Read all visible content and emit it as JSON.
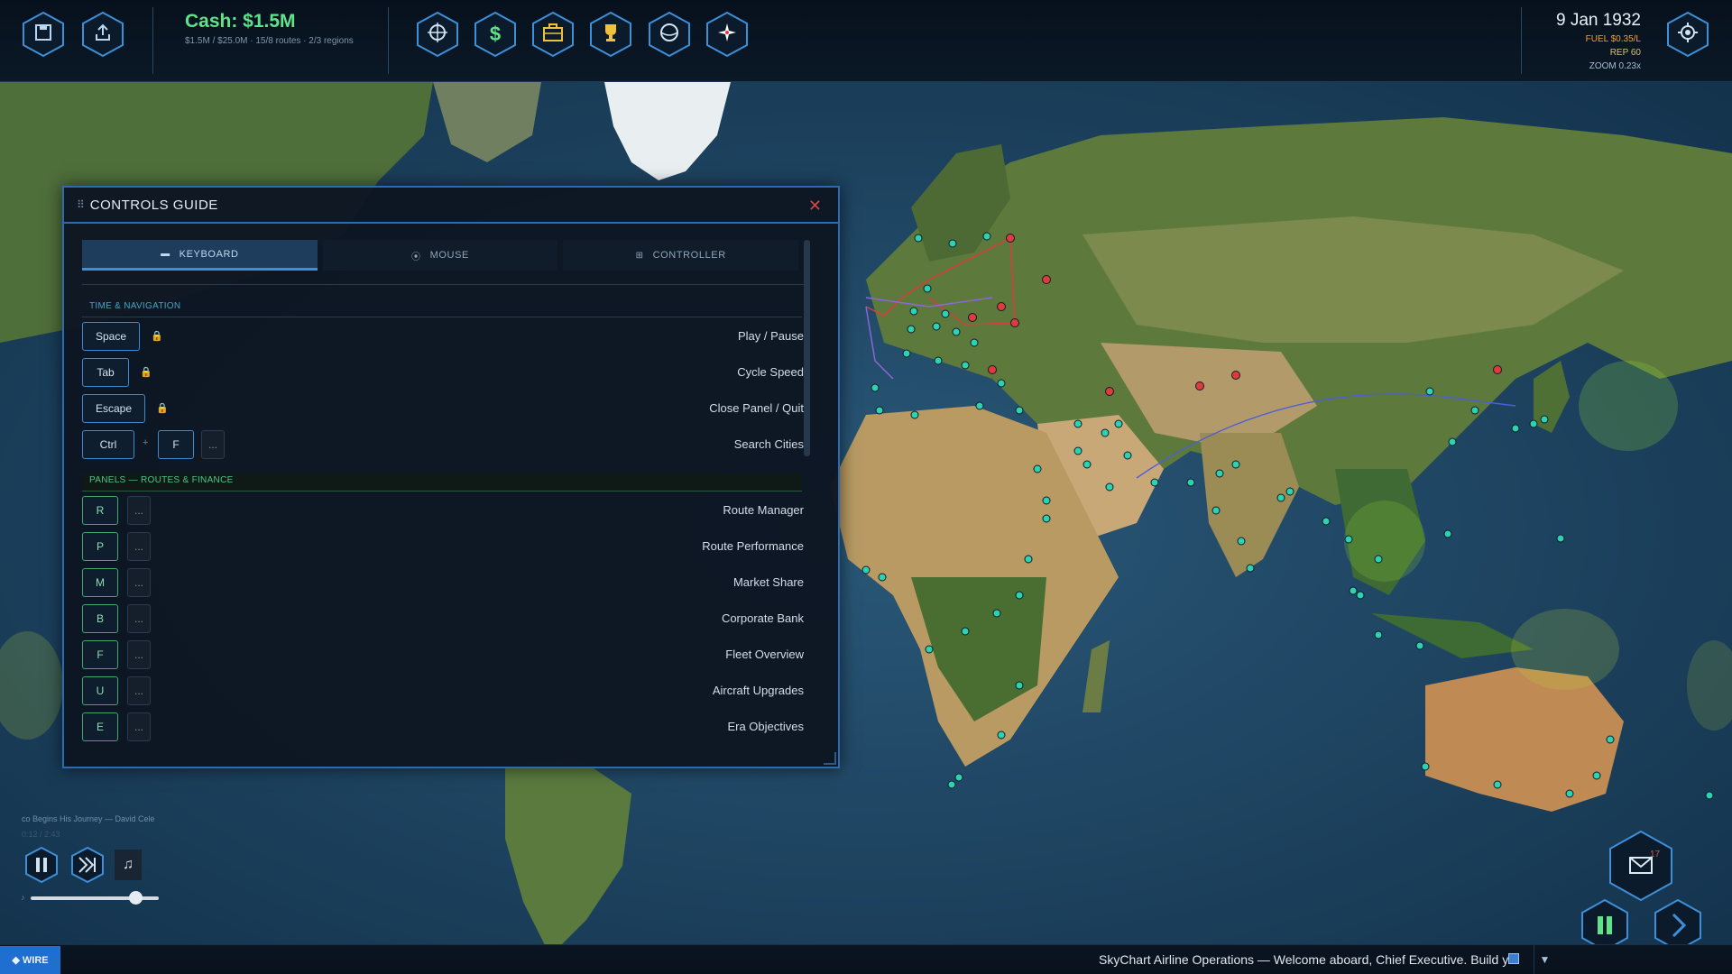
{
  "toolbar": {
    "save_icon": "save-icon",
    "export_icon": "export-icon",
    "cash_label": "Cash: $1.5M",
    "cash_sub": "$1.5M / $25.0M  ·  15/8 routes  ·  2/3 regions",
    "tool_icons": [
      "crosshair-icon",
      "dollar-icon",
      "briefcase-icon",
      "trophy-icon",
      "globe-icon",
      "compass-icon"
    ],
    "date": "9 Jan 1932",
    "fuel": "FUEL $0.35/L",
    "rep": "REP 60",
    "zoom": "ZOOM 0.23x",
    "settings_icon": "settings-icon"
  },
  "panel": {
    "title": "CONTROLS GUIDE",
    "tabs": [
      {
        "label": "KEYBOARD",
        "icon": "keyboard-icon",
        "active": true
      },
      {
        "label": "MOUSE",
        "icon": "mouse-icon",
        "active": false
      },
      {
        "label": "CONTROLLER",
        "icon": "controller-icon",
        "active": false
      }
    ],
    "sections": [
      {
        "title": "TIME & NAVIGATION"
      },
      {
        "title": "PANELS — ROUTES & FINANCE"
      }
    ],
    "bindings": [
      {
        "keys": [
          "Space"
        ],
        "action": "Play / Pause",
        "locked": true
      },
      {
        "keys": [
          "Tab"
        ],
        "action": "Cycle Speed",
        "locked": true
      },
      {
        "keys": [
          "Escape"
        ],
        "action": "Close Panel / Quit",
        "locked": true
      },
      {
        "keys": [
          "Ctrl",
          "+",
          "F",
          "..."
        ],
        "action": "Search Cities",
        "locked": false
      },
      {
        "keys": [
          "R",
          "..."
        ],
        "action": "Route Manager"
      },
      {
        "keys": [
          "P",
          "..."
        ],
        "action": "Route Performance"
      },
      {
        "keys": [
          "M",
          "..."
        ],
        "action": "Market Share"
      },
      {
        "keys": [
          "B",
          "..."
        ],
        "action": "Corporate Bank"
      },
      {
        "keys": [
          "F",
          "..."
        ],
        "action": "Fleet Overview"
      },
      {
        "keys": [
          "U",
          "..."
        ],
        "action": "Aircraft Upgrades"
      },
      {
        "keys": [
          "E",
          "..."
        ],
        "action": "Era Objectives"
      }
    ]
  },
  "music": {
    "song": "co Begins His Journey — David Cele",
    "time": "0:12 / 2:43",
    "note_icon": "♫",
    "volume": 0.82
  },
  "hud": {
    "mail_count": "17"
  },
  "ticker": {
    "wire_label": "◆ WIRE",
    "text": "SkyChart Airline Operations — Welcome aboard, Chief Executive. Build yo",
    "toggle": "▼"
  },
  "colors": {
    "cash": "#5fe38a",
    "fuel": "#f0a22e",
    "rep": "#d8c07a",
    "zoom": "#a8bed2",
    "accent": "#2b6cb0",
    "route_red": "#e03a3a",
    "city_teal": "#2ed2b0"
  }
}
